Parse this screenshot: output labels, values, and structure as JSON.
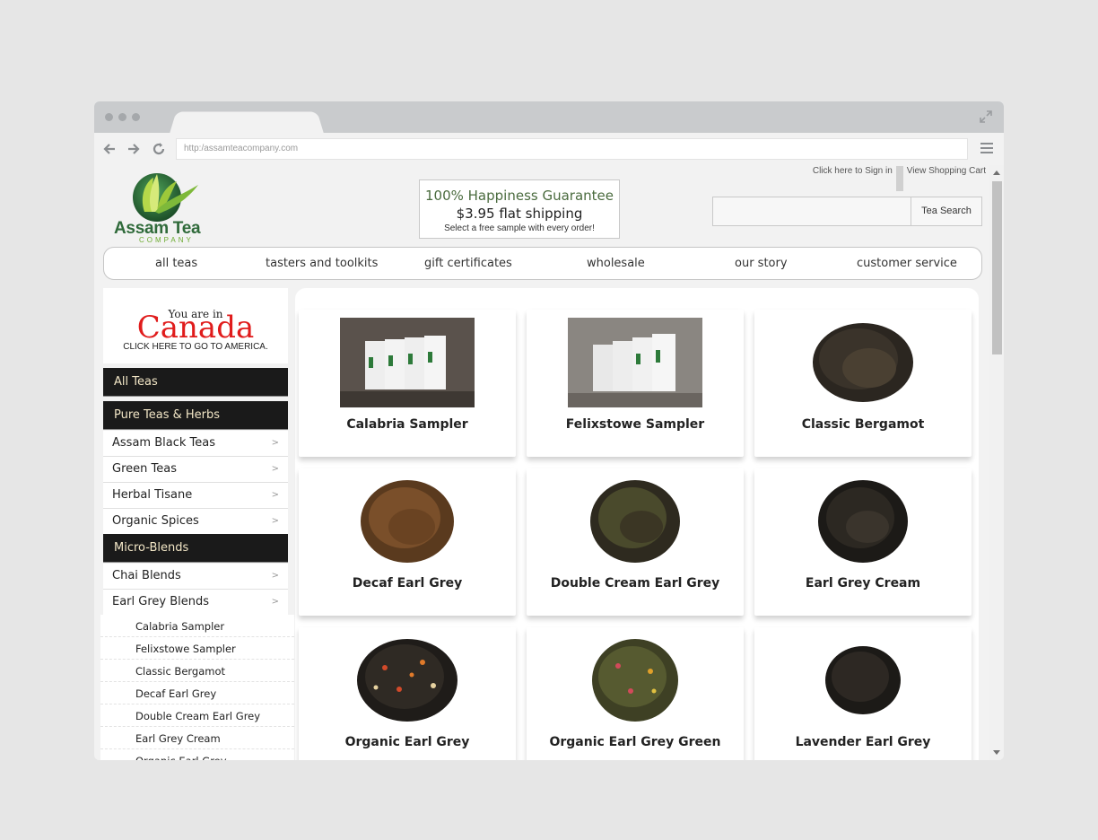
{
  "browser": {
    "url": "http:/assamteacompany.com"
  },
  "header": {
    "logo_name": "Assam Tea",
    "logo_sub": "COMPANY",
    "guarantee_line1": "100% Happiness Guarantee",
    "guarantee_line2": "$3.95 flat shipping",
    "guarantee_line3": "Select a free sample with every order!",
    "signin": "Click here to Sign in",
    "cart": "View Shopping Cart",
    "search_button": "Tea Search"
  },
  "nav": [
    "all teas",
    "tasters and toolkits",
    "gift certificates",
    "wholesale",
    "our story",
    "customer service"
  ],
  "location": {
    "small": "You are in",
    "big": "Canada",
    "link": "CLICK HERE TO GO TO AMERICA."
  },
  "sidebar": {
    "all_teas": "All Teas",
    "pure": "Pure Teas & Herbs",
    "pure_items": [
      "Assam Black Teas",
      "Green Teas",
      "Herbal Tisane",
      "Organic Spices"
    ],
    "micro": "Micro-Blends",
    "micro_items": [
      "Chai Blends",
      "Earl Grey Blends"
    ],
    "chevron": ">",
    "sub_items": [
      "Calabria Sampler",
      "Felixstowe Sampler",
      "Classic Bergamot",
      "Decaf Earl Grey",
      "Double Cream Earl Grey",
      "Earl Grey Cream",
      "Organic Earl Grey"
    ]
  },
  "products": [
    {
      "name": "Calabria Sampler",
      "image": "sampler-bags"
    },
    {
      "name": "Felixstowe Sampler",
      "image": "sampler-bags"
    },
    {
      "name": "Classic Bergamot",
      "image": "loose-tea-dark"
    },
    {
      "name": "Decaf Earl Grey",
      "image": "loose-tea-brown"
    },
    {
      "name": "Double Cream Earl Grey",
      "image": "loose-tea-mixed"
    },
    {
      "name": "Earl Grey Cream",
      "image": "loose-tea-black"
    },
    {
      "name": "Organic Earl Grey",
      "image": "loose-tea-flowers"
    },
    {
      "name": "Organic Earl Grey Green",
      "image": "loose-tea-green"
    },
    {
      "name": "Lavender Earl Grey",
      "image": "loose-tea-black"
    }
  ],
  "colors": {
    "accent_green": "#2f6a3a",
    "header_dark": "#1a1a1a",
    "canada_red": "#e01c1c"
  }
}
